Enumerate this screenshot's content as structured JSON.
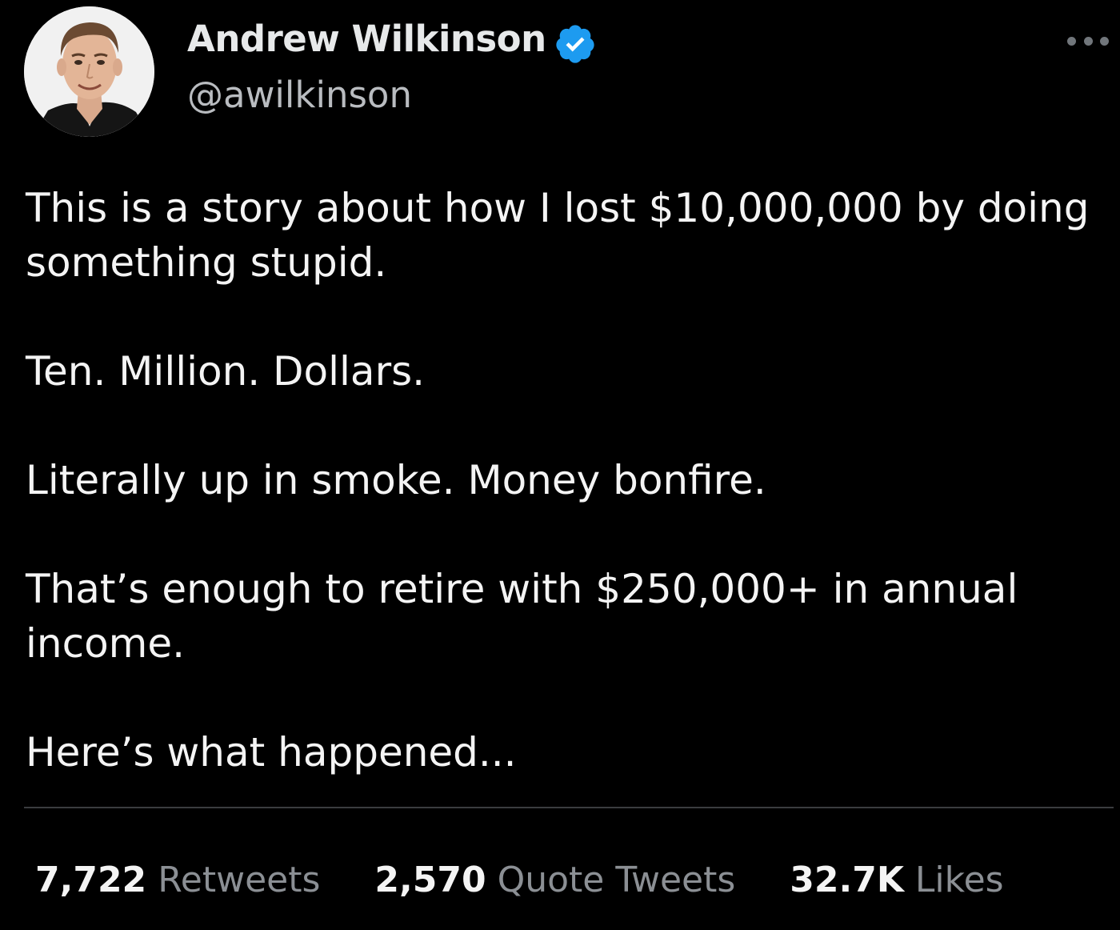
{
  "author": {
    "name": "Andrew Wilkinson",
    "handle": "@awilkinson",
    "verified": true,
    "verified_color": "#1d9bf0",
    "avatar_icon": "profile-photo"
  },
  "menu_icon": "more-options-icon",
  "tweet": {
    "paragraphs": [
      "This is a story about how I lost $10,000,000 by doing something stupid.",
      "Ten. Million. Dollars.",
      "Literally up in smoke. Money bonfire.",
      "That’s enough to retire with $250,000+ in annual income.",
      "Here’s what happened..."
    ]
  },
  "stats": {
    "retweets_count": "7,722",
    "retweets_label": "Retweets",
    "quotes_count": "2,570",
    "quotes_label": "Quote Tweets",
    "likes_count": "32.7K",
    "likes_label": "Likes"
  },
  "colors": {
    "background": "#000000",
    "text": "#e7e9ea",
    "secondary_text": "#8b8f94",
    "divider": "#3a3c3f"
  }
}
